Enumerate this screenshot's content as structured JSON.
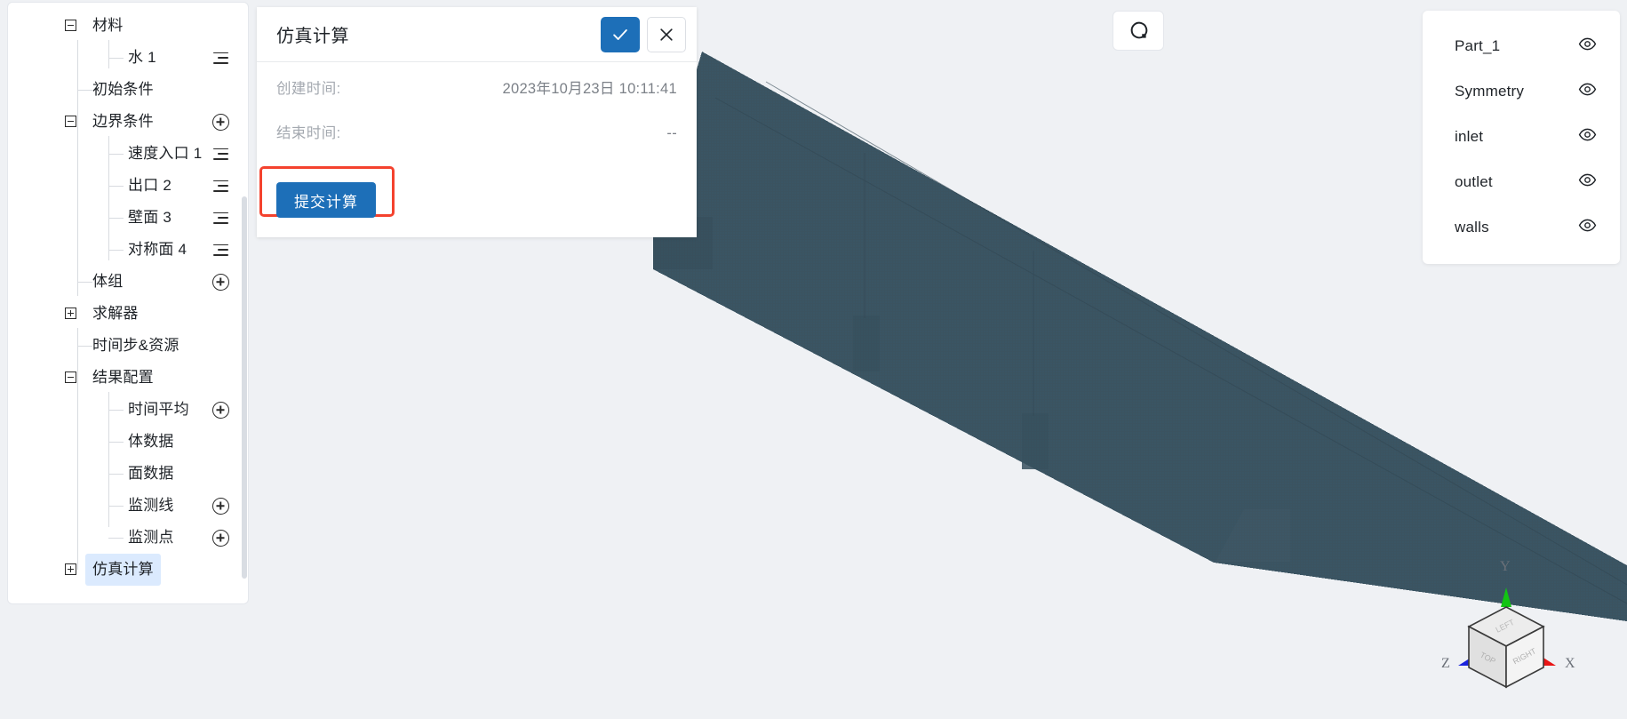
{
  "tree": {
    "nodes": [
      {
        "label": "材料",
        "depth": 0,
        "toggle": "minus",
        "action": "none",
        "name": "tree-node-material"
      },
      {
        "label": "水 1",
        "depth": 2,
        "toggle": "none",
        "action": "lines",
        "name": "tree-node-water-1"
      },
      {
        "label": "初始条件",
        "depth": 1,
        "toggle": "none",
        "action": "none",
        "name": "tree-node-initial-conditions"
      },
      {
        "label": "边界条件",
        "depth": 0,
        "toggle": "minus",
        "action": "plus-circle",
        "name": "tree-node-boundary-conditions"
      },
      {
        "label": "速度入口 1",
        "depth": 2,
        "toggle": "none",
        "action": "lines",
        "name": "tree-node-velocity-inlet-1"
      },
      {
        "label": "出口 2",
        "depth": 2,
        "toggle": "none",
        "action": "lines",
        "name": "tree-node-outlet-2"
      },
      {
        "label": "壁面 3",
        "depth": 2,
        "toggle": "none",
        "action": "lines",
        "name": "tree-node-wall-3"
      },
      {
        "label": "对称面 4",
        "depth": 2,
        "toggle": "none",
        "action": "lines",
        "name": "tree-node-symmetry-plane-4"
      },
      {
        "label": "体组",
        "depth": 1,
        "toggle": "none",
        "action": "plus-circle",
        "name": "tree-node-volume-group"
      },
      {
        "label": "求解器",
        "depth": 0,
        "toggle": "plus",
        "action": "none",
        "name": "tree-node-solver"
      },
      {
        "label": "时间步&资源",
        "depth": 1,
        "toggle": "none",
        "action": "none",
        "name": "tree-node-timestep-resources"
      },
      {
        "label": "结果配置",
        "depth": 0,
        "toggle": "minus",
        "action": "none",
        "name": "tree-node-result-config"
      },
      {
        "label": "时间平均",
        "depth": 2,
        "toggle": "none",
        "action": "plus-circle",
        "name": "tree-node-time-average"
      },
      {
        "label": "体数据",
        "depth": 2,
        "toggle": "none",
        "action": "none",
        "name": "tree-node-volume-data"
      },
      {
        "label": "面数据",
        "depth": 2,
        "toggle": "none",
        "action": "none",
        "name": "tree-node-surface-data"
      },
      {
        "label": "监测线",
        "depth": 2,
        "toggle": "none",
        "action": "plus-circle",
        "name": "tree-node-monitor-line"
      },
      {
        "label": "监测点",
        "depth": 2,
        "toggle": "none",
        "action": "plus-circle",
        "name": "tree-node-monitor-point"
      },
      {
        "label": "仿真计算",
        "depth": 0,
        "toggle": "plus",
        "action": "none",
        "name": "tree-node-simulation-run",
        "selected": true
      }
    ]
  },
  "dialog": {
    "title": "仿真计算",
    "confirm_icon": "check-icon",
    "cancel_icon": "close-icon",
    "rows": [
      {
        "label": "创建时间:",
        "value": "2023年10月23日 10:11:41"
      },
      {
        "label": "结束时间:",
        "value": "--"
      }
    ],
    "submit_label": "提交计算",
    "accent_color": "#1d6fb8",
    "highlight_color": "#f4422e"
  },
  "toolbar": {
    "reset_icon": "reset-rotate-icon"
  },
  "parts": {
    "items": [
      {
        "name": "Part_1",
        "visibility_icon": "eye-icon"
      },
      {
        "name": "Symmetry",
        "visibility_icon": "eye-icon"
      },
      {
        "name": "inlet",
        "visibility_icon": "eye-icon"
      },
      {
        "name": "outlet",
        "visibility_icon": "eye-icon"
      },
      {
        "name": "walls",
        "visibility_icon": "eye-icon"
      }
    ]
  },
  "gizmo": {
    "axes": [
      {
        "label": "Y",
        "color": "#12c412"
      },
      {
        "label": "X",
        "color": "#e81515"
      },
      {
        "label": "Z",
        "color": "#1a23dd"
      }
    ],
    "faces": [
      "TOP",
      "LEFT",
      "RIGHT"
    ]
  },
  "viewport": {
    "mesh_color": "#3b5360",
    "background_color": "#eff1f4"
  }
}
